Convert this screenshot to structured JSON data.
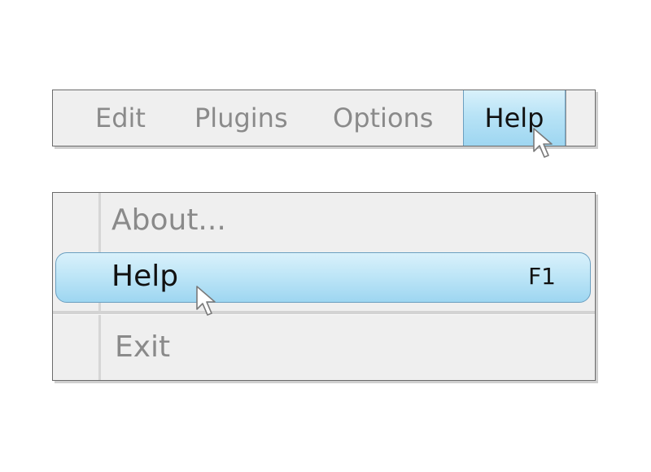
{
  "menubar": {
    "items": [
      {
        "label": "Edit"
      },
      {
        "label": "Plugins"
      },
      {
        "label": "Options"
      },
      {
        "label": "Help"
      }
    ],
    "active_item": "Help"
  },
  "dropdown": {
    "items": [
      {
        "label": "About..."
      },
      {
        "label": "Help",
        "shortcut": "F1"
      },
      {
        "label": "Exit"
      }
    ],
    "highlighted_item": "Help"
  },
  "icons": {
    "cursor": "arrow-pointer-icon"
  },
  "colors": {
    "highlight_top": "#d9f1fb",
    "highlight_bottom": "#9ed6f1",
    "highlight_border": "#6b9fc0",
    "menu_background": "#efefef",
    "inactive_text": "#8a8a8a",
    "active_text": "#111111"
  }
}
